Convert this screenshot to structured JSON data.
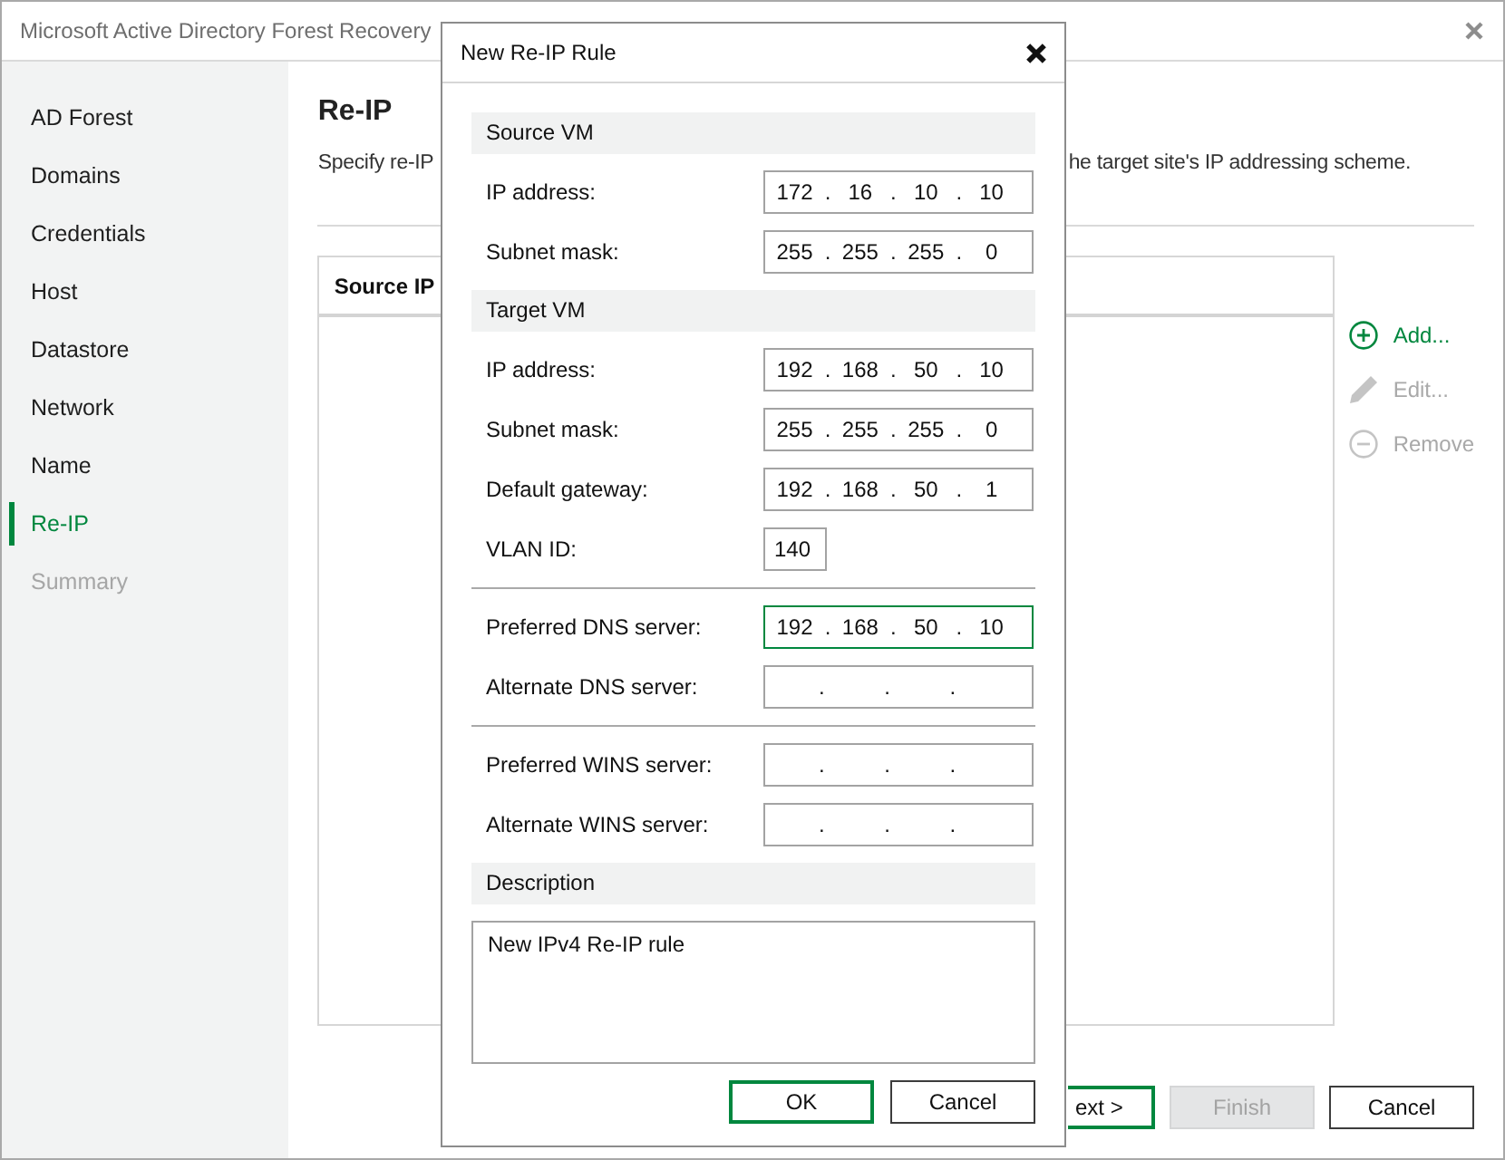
{
  "window": {
    "title": "Microsoft Active Directory Forest Recovery"
  },
  "sidebar": {
    "items": [
      {
        "label": "AD Forest",
        "selected": false,
        "disabled": false
      },
      {
        "label": "Domains",
        "selected": false,
        "disabled": false
      },
      {
        "label": "Credentials",
        "selected": false,
        "disabled": false
      },
      {
        "label": "Host",
        "selected": false,
        "disabled": false
      },
      {
        "label": "Datastore",
        "selected": false,
        "disabled": false
      },
      {
        "label": "Network",
        "selected": false,
        "disabled": false
      },
      {
        "label": "Name",
        "selected": false,
        "disabled": false
      },
      {
        "label": "Re-IP",
        "selected": true,
        "disabled": false
      },
      {
        "label": "Summary",
        "selected": false,
        "disabled": true
      }
    ]
  },
  "page": {
    "heading": "Re-IP",
    "description_visible_parts": [
      "Specify re-IP",
      "he target site's IP addressing scheme."
    ]
  },
  "table": {
    "columns": [
      {
        "label": "Source IP"
      }
    ]
  },
  "actions": [
    {
      "kind": "add",
      "label": "Add...",
      "disabled": false
    },
    {
      "kind": "edit",
      "label": "Edit...",
      "disabled": true
    },
    {
      "kind": "remove",
      "label": "Remove",
      "disabled": true
    }
  ],
  "wizard_buttons": [
    {
      "label": "ext >",
      "kind": "primary",
      "disabled": false
    },
    {
      "label": "Finish",
      "kind": "normal",
      "disabled": true
    },
    {
      "label": "Cancel",
      "kind": "normal",
      "disabled": false
    }
  ],
  "dialog": {
    "title": "New Re-IP Rule",
    "items": [
      {
        "kind": "header",
        "label": "Source VM"
      },
      {
        "kind": "ip",
        "label": "IP address:",
        "value": "172 . 16 . 10 . 10",
        "focused": false
      },
      {
        "kind": "ip",
        "label": "Subnet mask:",
        "value": "255 . 255 . 255 . 0",
        "focused": false
      },
      {
        "kind": "header",
        "label": "Target VM"
      },
      {
        "kind": "ip",
        "label": "IP address:",
        "value": "192 . 168 . 50 . 10",
        "focused": false
      },
      {
        "kind": "ip",
        "label": "Subnet mask:",
        "value": "255 . 255 . 255 . 0",
        "focused": false
      },
      {
        "kind": "ip",
        "label": "Default gateway:",
        "value": "192 . 168 . 50 . 1",
        "focused": false
      },
      {
        "kind": "number",
        "label": "VLAN ID:",
        "value": "140",
        "focused": false
      },
      {
        "kind": "divider"
      },
      {
        "kind": "ip",
        "label": "Preferred DNS server:",
        "value": "192 . 168 . 50 . 10",
        "focused": true
      },
      {
        "kind": "ip",
        "label": "Alternate DNS server:",
        "value": ". . .",
        "focused": false
      },
      {
        "kind": "divider"
      },
      {
        "kind": "ip",
        "label": "Preferred WINS server:",
        "value": ". . .",
        "focused": false
      },
      {
        "kind": "ip",
        "label": "Alternate WINS server:",
        "value": ". . .",
        "focused": false
      },
      {
        "kind": "header",
        "label": "Description"
      },
      {
        "kind": "text_area",
        "value": "New IPv4 Re-IP rule"
      }
    ],
    "buttons": [
      {
        "label": "OK",
        "kind": "primary"
      },
      {
        "label": "Cancel",
        "kind": "normal"
      }
    ]
  }
}
